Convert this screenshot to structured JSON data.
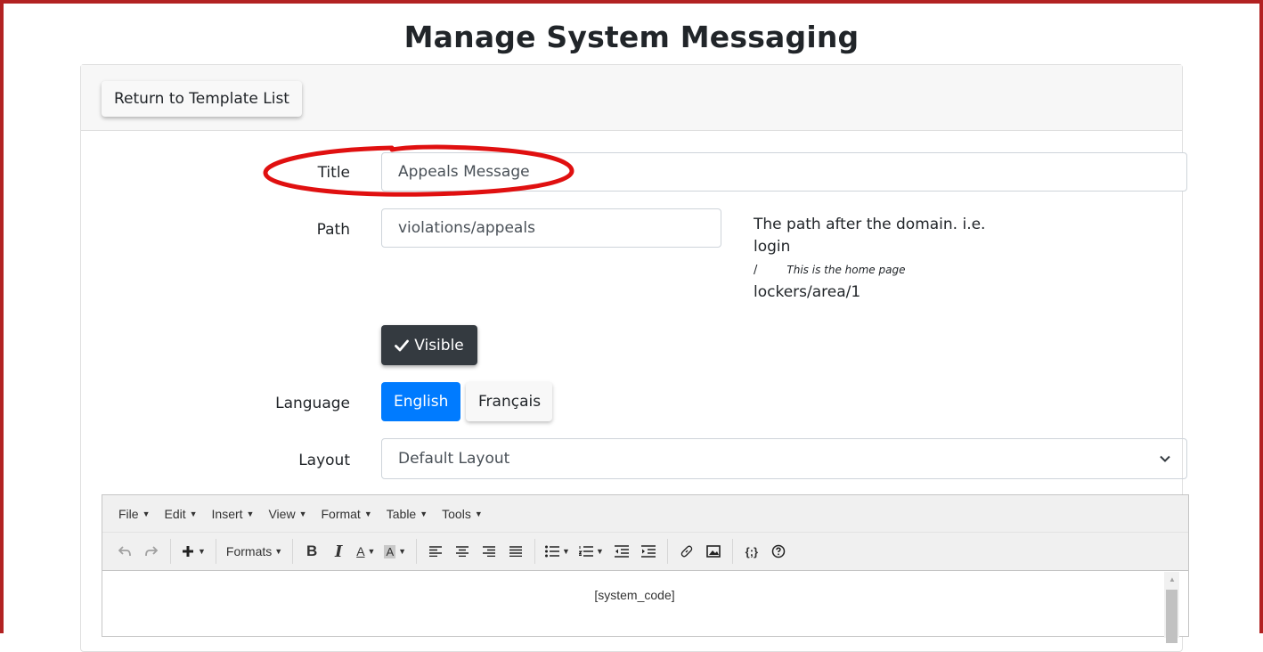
{
  "page": {
    "title": "Manage System Messaging"
  },
  "header": {
    "return_label": "Return to Template List"
  },
  "form": {
    "title_label": "Title",
    "title_value": "Appeals Message",
    "path_label": "Path",
    "path_value": "violations/appeals",
    "path_help": {
      "line1": "The path after the domain. i.e.",
      "line2": "login",
      "line3_slash": "/",
      "line3_note": "This is the home page",
      "line4": "lockers/area/1"
    },
    "visible_label": "Visible",
    "language_label": "Language",
    "language_options": [
      "English",
      "Français"
    ],
    "language_selected": "English",
    "layout_label": "Layout",
    "layout_value": "Default Layout"
  },
  "editor": {
    "menu": [
      "File",
      "Edit",
      "Insert",
      "View",
      "Format",
      "Table",
      "Tools"
    ],
    "toolbar": {
      "formats_label": "Formats",
      "bold": "B",
      "italic": "I",
      "font_color": "A",
      "bg_color": "A",
      "source_code": "{;}"
    },
    "content": "[system_code]"
  },
  "colors": {
    "frame": "#b22222",
    "annotation": "#e01010",
    "primary": "#007bff",
    "dark": "#343a40"
  },
  "icons": [
    "check-icon",
    "undo-icon",
    "redo-icon",
    "plus-icon",
    "align-left-icon",
    "align-center-icon",
    "align-right-icon",
    "align-justify-icon",
    "bullet-list-icon",
    "numbered-list-icon",
    "outdent-icon",
    "indent-icon",
    "link-icon",
    "image-icon",
    "help-icon",
    "chevron-down-icon"
  ]
}
